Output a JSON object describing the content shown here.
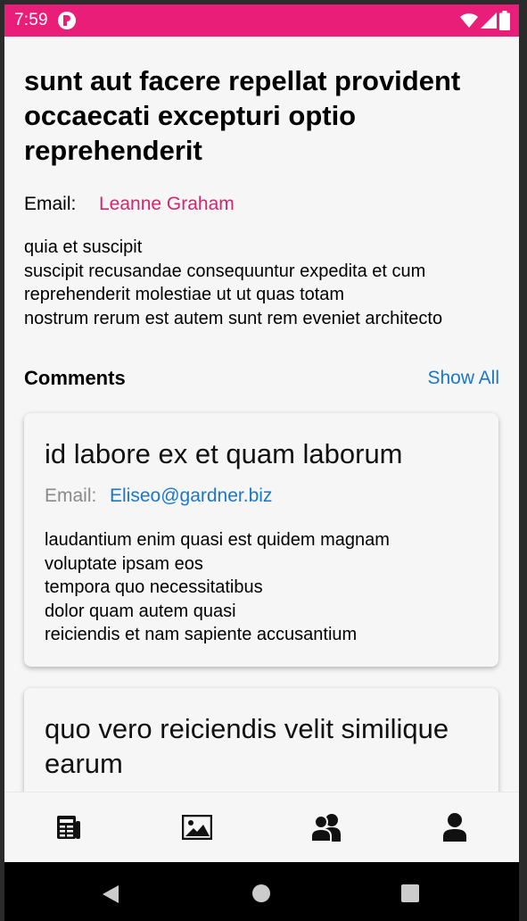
{
  "status_bar": {
    "time": "7:59",
    "icons": [
      "app-notification-icon",
      "wifi-icon",
      "signal-icon",
      "battery-icon"
    ]
  },
  "post": {
    "title": "sunt aut facere repellat provident occaecati excepturi optio reprehenderit",
    "email_label": "Email:",
    "author": "Leanne Graham",
    "body": "quia et suscipit\nsuscipit recusandae consequuntur expedita et cum\nreprehenderit molestiae ut ut quas totam\nnostrum rerum est autem sunt rem eveniet architecto"
  },
  "comments": {
    "title": "Comments",
    "show_all": "Show All",
    "items": [
      {
        "name": "id labore ex et quam laborum",
        "email_label": "Email:",
        "email": "Eliseo@gardner.biz",
        "body": "laudantium enim quasi est quidem magnam\nvoluptate ipsam eos\ntempora quo necessitatibus\ndolor quam autem quasi\nreiciendis et nam sapiente accusantium"
      },
      {
        "name": "quo vero reiciendis velit similique earum"
      }
    ]
  },
  "bottom_nav": {
    "items": [
      "posts-icon",
      "photos-icon",
      "users-icon",
      "profile-icon"
    ]
  },
  "system_nav": {
    "items": [
      "back-icon",
      "home-icon",
      "recents-icon"
    ]
  },
  "colors": {
    "status_bar": "#e91e79",
    "author_accent": "#d6246e",
    "link": "#1a77c9",
    "background": "#f6f6f6"
  }
}
